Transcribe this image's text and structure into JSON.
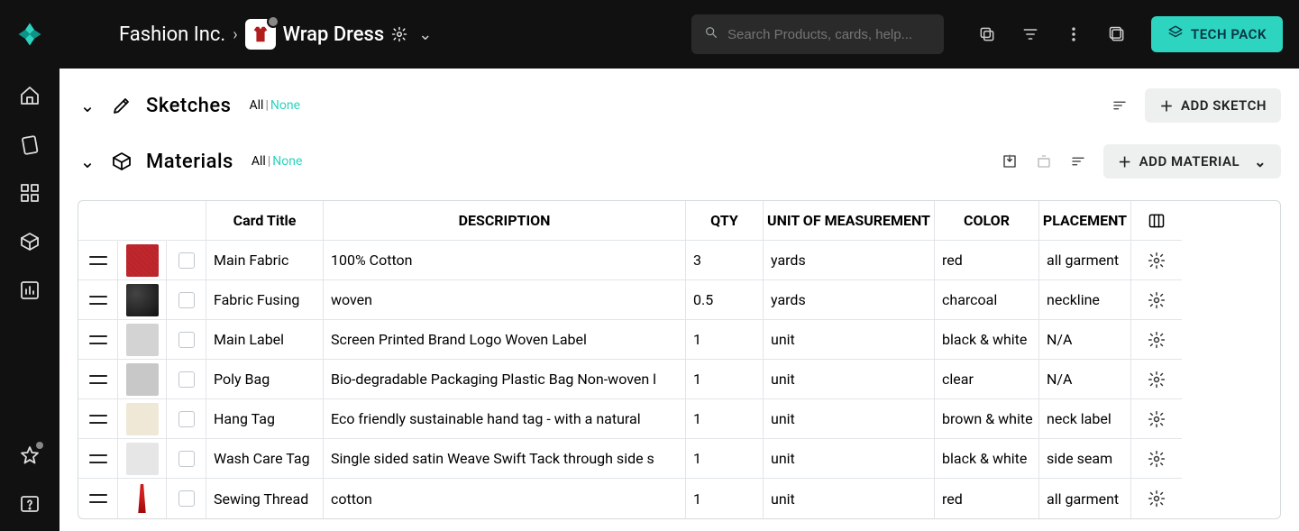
{
  "header": {
    "company": "Fashion Inc.",
    "product": "Wrap Dress",
    "search_placeholder": "Search Products, cards, help...",
    "tech_pack_label": "TECH PACK"
  },
  "sections": {
    "sketches": {
      "title": "Sketches",
      "all": "All",
      "none": "None",
      "add_label": "ADD SKETCH"
    },
    "materials": {
      "title": "Materials",
      "all": "All",
      "none": "None",
      "add_label": "ADD MATERIAL"
    }
  },
  "table": {
    "headers": {
      "card_title": "Card Title",
      "description": "DESCRIPTION",
      "qty": "QTY",
      "unit": "UNIT OF MEASUREMENT",
      "color": "COLOR",
      "placement": "PLACEMENT"
    },
    "rows": [
      {
        "thumb": "red",
        "title": "Main Fabric",
        "desc": "100% Cotton",
        "qty": "3",
        "unit": "yards",
        "color": "red",
        "placement": "all garment"
      },
      {
        "thumb": "charcoal",
        "title": "Fabric Fusing",
        "desc": "woven",
        "qty": "0.5",
        "unit": "yards",
        "color": "charcoal",
        "placement": "neckline"
      },
      {
        "thumb": "label",
        "title": "Main Label",
        "desc": "Screen Printed Brand Logo Woven Label",
        "qty": "1",
        "unit": "unit",
        "color": "black & white",
        "placement": "N/A"
      },
      {
        "thumb": "bag",
        "title": "Poly Bag",
        "desc": "Bio-degradable Packaging Plastic Bag Non-woven l",
        "qty": "1",
        "unit": "unit",
        "color": "clear",
        "placement": "N/A"
      },
      {
        "thumb": "hang",
        "title": "Hang Tag",
        "desc": "Eco friendly sustainable hand tag - with a natural ",
        "qty": "1",
        "unit": "unit",
        "color": "brown & white",
        "placement": "neck label"
      },
      {
        "thumb": "wash",
        "title": "Wash Care Tag",
        "desc": "Single sided satin Weave Swift Tack through side s",
        "qty": "1",
        "unit": "unit",
        "color": "black & white",
        "placement": "side seam"
      },
      {
        "thumb": "thread",
        "title": "Sewing Thread",
        "desc": "cotton",
        "qty": "1",
        "unit": "unit",
        "color": "red",
        "placement": "all garment"
      }
    ]
  }
}
